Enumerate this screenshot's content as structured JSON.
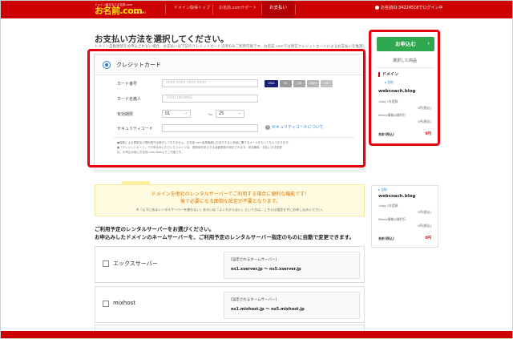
{
  "header": {
    "logo_tagline": "ドメイン取るならお名前.com",
    "logo_name": "お名前.com",
    "logo_sub": "by GMO",
    "nav": [
      "ドメイン取得トップ",
      "お名前.comサポート",
      "お支払い"
    ],
    "user_text": "お名前ID:34224518でログイン中"
  },
  "main": {
    "title": "お支払い方法を選択してください。",
    "intro": "ドメイン自動更新をお申込されない場合、お支払いは下記のクレジットカード決済のみご利用可能です。お名前.comでは現在クレジットカードによるお支払いを推奨しております。",
    "payment": {
      "method_label": "クレジットカード",
      "card_number_label": "カード番号",
      "card_number_placeholder": "0000 0000 0000 0000",
      "card_holder_label": "カード名義人",
      "card_holder_placeholder": "TARO ONAMAE",
      "expiry_label": "有効期限",
      "expiry_month": "01",
      "expiry_year": "25",
      "tilde": "～",
      "security_label": "セキュリティコード",
      "security_help": "セキュリティコードについて",
      "brands": [
        "VISA",
        "MC",
        "JCB",
        "AMEX",
        "DC"
      ],
      "notes": [
        "●複数による更新及び規約遵守は執行しておりません。お名前.com会員情報にお送りすると商品に関するメールをもって与えております。",
        "●「クレジットカード」でお申込みいただいたドメインは、更新時を防止する自動更新が設定されます。設定解除・支払い方法変更",
        "は、お申込み後にお名前.com Naviよりご可能です。"
      ],
      "notes_red": "自動更新"
    },
    "promo": {
      "line1": "ドメインを他社のレンタルサーバーでご利用する場合に便利な機能です！",
      "line2": "後で必要になる面倒な設定が不要となります。",
      "note": "※「以下にあるレンタルサーバーを使わない」あるいは「よくわからない」という方は、こちらは指定せずにお申し込みください。"
    },
    "guide_line1": "ご利用予定のレンタルサーバーをお選びください。",
    "guide_line2": "お申込みしたドメインのネームサーバーを、ご利用予定のレンタルサーバー指定のものに自動で変更できます。",
    "servers": [
      {
        "name": "エックスサーバー",
        "ns_heading": "[設定されるネームサーバー]",
        "ns_value": "ns1.xserver.jp 〜 ns5.xserver.jp"
      },
      {
        "name": "mixhost",
        "ns_heading": "[設定されるネームサーバー]",
        "ns_value": "ns1.mixhost.jp 〜 ns5.mixhost.jp"
      }
    ]
  },
  "sidebar": {
    "apply_label": "お申込む",
    "apply_arrow": "›",
    "selected_heading": "選択した商品",
    "section": "ドメイン",
    "remove_link": "▸ 全削",
    "domain": "webcoach.blog",
    "item1_label": ".blog 1年登録",
    "item1_price": "0円(税込)",
    "item2_label": "Whois情報公開代行",
    "item2_price": "0円(税込)",
    "total_label": "合計(税込)",
    "total_value": "0円"
  },
  "sidebar2": {
    "remove_link": "▸ 全削",
    "domain": "webcoach.blog",
    "item1_label": ".blog 1年登録",
    "item1_price": "0円(税込)",
    "item2_label": "Whois情報公開代行",
    "item2_price": "0円(税込)",
    "total_label": "合計(税込)",
    "total_value": "0円"
  },
  "colors": {
    "brand": "#cc0000",
    "accent": "#2fa84f",
    "annotation": "#e60012",
    "link": "#2d7fd0"
  }
}
